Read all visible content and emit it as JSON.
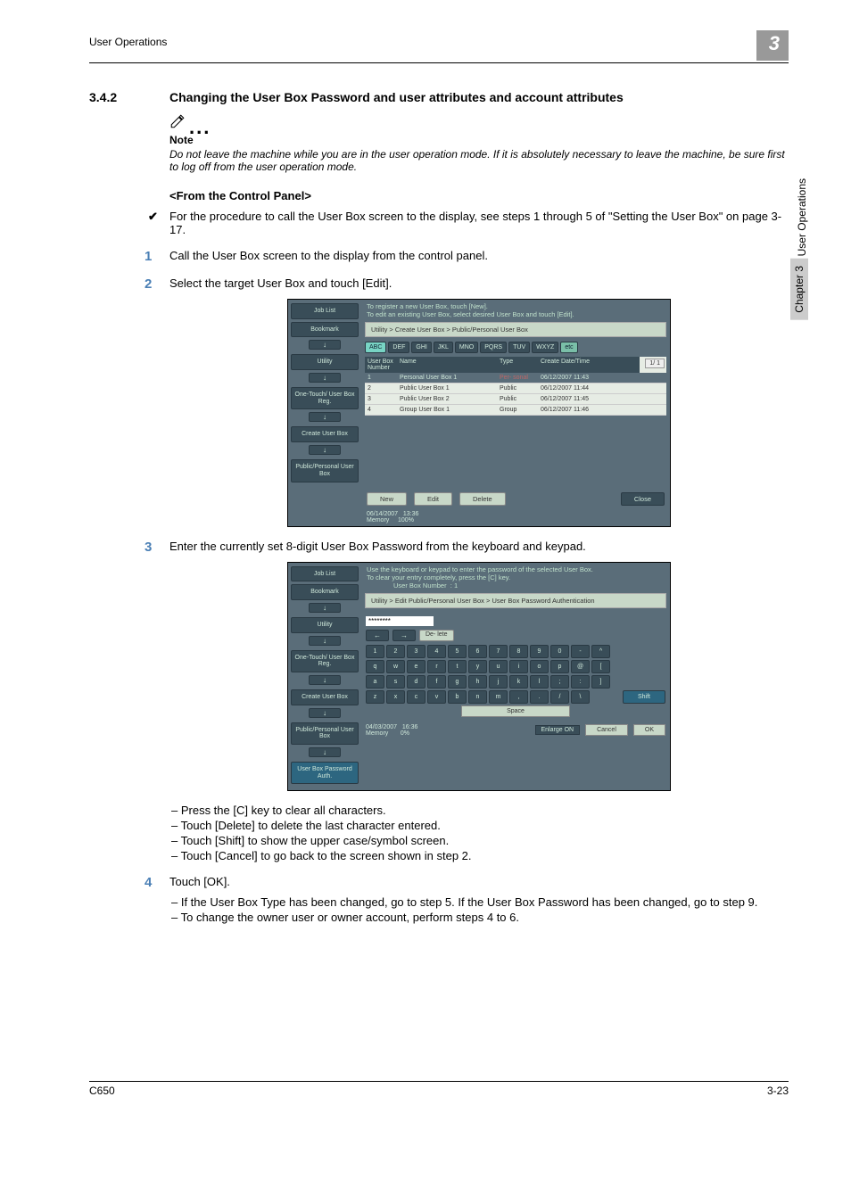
{
  "header": {
    "left": "User Operations",
    "badge": "3"
  },
  "side": {
    "label": "User Operations",
    "chapter": "Chapter 3"
  },
  "section": {
    "number": "3.4.2",
    "title": "Changing the User Box Password and user attributes and account attributes"
  },
  "note": {
    "label": "Note",
    "body": "Do not leave the machine while you are in the user operation mode. If it is absolutely necessary to leave the machine, be sure first to log off from the user operation mode."
  },
  "subHead": "<From the Control Panel>",
  "checkItem": "For the procedure to call the User Box screen to the display, see steps 1 through 5 of \"Setting the User Box\" on page 3-17.",
  "steps": {
    "s1": "Call the User Box screen to the display from the control panel.",
    "s2": "Select the target User Box and touch [Edit].",
    "s3": "Enter the currently set 8-digit User Box Password from the keyboard and keypad.",
    "s3_sub": [
      "Press the [C] key to clear all characters.",
      "Touch [Delete] to delete the last character entered.",
      "Touch [Shift] to show the upper case/symbol screen.",
      "Touch [Cancel] to go back to the screen shown in step 2."
    ],
    "s4": "Touch [OK].",
    "s4_sub": [
      "If the User Box Type has been changed, go to step 5. If the User Box Password has been changed, go to step 9.",
      "To change the owner user or owner account, perform steps 4 to 6."
    ]
  },
  "scr1": {
    "top1": "To register a new User Box, touch [New].",
    "top2": "To edit an existing User Box, select desired User Box and touch [Edit].",
    "breadcrumb": "Utility > Create User Box > Public/Personal User Box",
    "sidebuttons": [
      "Job List",
      "Bookmark",
      "Utility",
      "One-Touch/\nUser Box Reg.",
      "Create User Box",
      "Public/Personal\nUser Box"
    ],
    "alpha": [
      "ABC",
      "DEF",
      "GHI",
      "JKL",
      "MNO",
      "PQRS",
      "TUV",
      "WXYZ",
      "etc"
    ],
    "thead": [
      "User Box\nNumber",
      "Name",
      "Type",
      "Create Date/Time"
    ],
    "rows": [
      {
        "n": "1",
        "name": "Personal User Box 1",
        "type": "Per-\nsonal",
        "dt": "06/12/2007 11:43",
        "sel": true
      },
      {
        "n": "2",
        "name": "Public User Box 1",
        "type": "Public",
        "dt": "06/12/2007 11:44"
      },
      {
        "n": "3",
        "name": "Public User Box 2",
        "type": "Public",
        "dt": "06/12/2007 11:45"
      },
      {
        "n": "4",
        "name": "Group User Box 1",
        "type": "Group",
        "dt": "06/12/2007 11:46"
      }
    ],
    "pager": "1/  1",
    "botbtns": [
      "New",
      "Edit",
      "Delete"
    ],
    "close": "Close",
    "status": {
      "date": "06/14/2007",
      "time": "13:36",
      "mem": "Memory",
      "pct": "100%"
    }
  },
  "scr2": {
    "top1": "Use the keyboard or keypad to enter the password of the selected User Box.",
    "top2": "To clear your entry completely, press the [C] key.",
    "ubnlabel": "User Box\nNumber",
    "ubn": ": 1",
    "breadcrumb": "Utility > Edit Public/Personal User Box > User Box Password Authentication",
    "input": "********",
    "sidebuttons": [
      "Job List",
      "Bookmark",
      "Utility",
      "One-Touch/\nUser Box Reg.",
      "Create User Box",
      "Public/Personal\nUser Box",
      "User Box\nPassword Auth."
    ],
    "delete": "De-\nlete",
    "rows": [
      [
        "1",
        "2",
        "3",
        "4",
        "5",
        "6",
        "7",
        "8",
        "9",
        "0",
        "-",
        "^"
      ],
      [
        "q",
        "w",
        "e",
        "r",
        "t",
        "y",
        "u",
        "i",
        "o",
        "p",
        "@",
        "["
      ],
      [
        "a",
        "s",
        "d",
        "f",
        "g",
        "h",
        "j",
        "k",
        "l",
        ";",
        ":",
        "]"
      ],
      [
        "z",
        "x",
        "c",
        "v",
        "b",
        "n",
        "m",
        ",",
        ".",
        "/",
        "\\"
      ]
    ],
    "shift": "Shift",
    "space": "Space",
    "enlarge": "Enlarge\nON",
    "cancel": "Cancel",
    "ok": "OK",
    "status": {
      "date": "04/03/2007",
      "time": "16:36",
      "mem": "Memory",
      "pct": "0%"
    }
  },
  "footer": {
    "left": "C650",
    "right": "3-23"
  }
}
